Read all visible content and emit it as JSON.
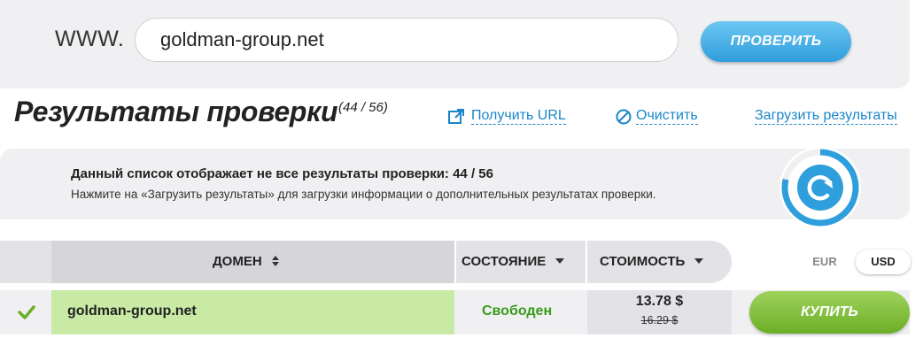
{
  "search": {
    "prefix": "WWW.",
    "value": "goldman-group.net",
    "button_label": "ПРОВЕРИТЬ"
  },
  "results": {
    "title": "Результаты проверки",
    "count": "(44 / 56)",
    "links": {
      "get_url": "Получить URL",
      "clear": "Очистить",
      "load": "Загрузить результаты"
    }
  },
  "info": {
    "main": "Данный список отображает не все результаты проверки: 44 / 56",
    "sub": "Нажмите на «Загрузить результаты» для загрузки информации о дополнительных результатах проверки.",
    "progress": 0.786
  },
  "table": {
    "columns": {
      "domain": "ДОМЕН",
      "status": "СОСТОЯНИЕ",
      "price": "СТОИМОСТЬ"
    },
    "currencies": {
      "eur": "EUR",
      "usd": "USD",
      "selected": "USD"
    },
    "rows": [
      {
        "checked": true,
        "domain": "goldman-group.net",
        "status": "Свободен",
        "price": "13.78 $",
        "old_price": "16.29 $",
        "buy_label": "КУПИТЬ"
      }
    ]
  },
  "colors": {
    "accent_blue": "#2f9edc",
    "link_blue": "#1a86c8",
    "available_green": "#3a9a1c",
    "buy_green": "#7ab934",
    "row_highlight": "#c9eaa4",
    "panel_gray": "#f0f0f2"
  },
  "icons": {
    "get_url": "external-link-icon",
    "clear": "clear-circle-icon",
    "refresh": "refresh-icon",
    "sort_domain": "sort-updown-icon",
    "sort_status": "caret-down-icon",
    "sort_price": "caret-down-icon",
    "row_check": "checkmark-icon"
  }
}
